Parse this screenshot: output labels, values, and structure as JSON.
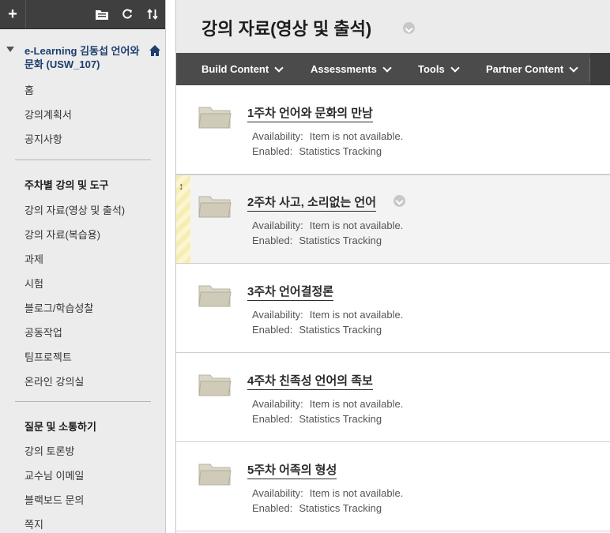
{
  "sidebar": {
    "toolbar": {
      "add": "+"
    },
    "course_title": "e-Learning 김동섭 언어와 문화 (USW_107)",
    "items_top": [
      "홈",
      "강의계획서",
      "공지사항"
    ],
    "section1": {
      "heading": "주차별 강의 및 도구",
      "items": [
        "강의 자료(영상 및 출석)",
        "강의 자료(복습용)",
        "과제",
        "시험",
        "블로그/학습성찰",
        "공동작업",
        "팀프로젝트",
        "온라인 강의실"
      ]
    },
    "section2": {
      "heading": "질문 및 소통하기",
      "items": [
        "강의 토론방",
        "교수님 이메일",
        "블랙보드 문의",
        "쪽지"
      ]
    }
  },
  "header": {
    "title": "강의 자료(영상 및 출석)"
  },
  "action_bar": {
    "items": [
      "Build Content",
      "Assessments",
      "Tools",
      "Partner Content"
    ]
  },
  "content": {
    "availability_label": "Availability:",
    "enabled_label": "Enabled:",
    "items": [
      {
        "title": "1주차 언어와 문화의 만남",
        "availability": "Item is not available.",
        "enabled": "Statistics Tracking"
      },
      {
        "title": "2주차 사고, 소리없는 언어",
        "availability": "Item is not available.",
        "enabled": "Statistics Tracking"
      },
      {
        "title": "3주차 언어결정론",
        "availability": "Item is not available.",
        "enabled": "Statistics Tracking"
      },
      {
        "title": "4주차 친족성 언어의 족보",
        "availability": "Item is not available.",
        "enabled": "Statistics Tracking"
      },
      {
        "title": "5주차 어족의 형성",
        "availability": "Item is not available.",
        "enabled": "Statistics Tracking"
      }
    ]
  },
  "icons": {
    "toolbar": [
      "plus-icon",
      "folder-view-icon",
      "refresh-icon",
      "sort-icon"
    ],
    "home": "home-icon",
    "item": "folder-icon",
    "drag": "drag-handle-icon"
  }
}
